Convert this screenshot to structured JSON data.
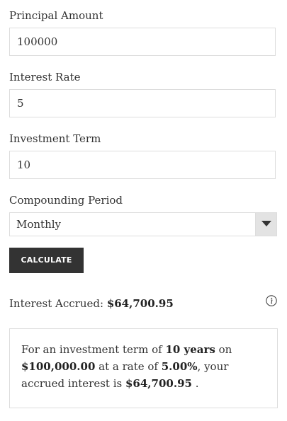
{
  "fields": {
    "principal": {
      "label": "Principal Amount",
      "value": "100000"
    },
    "rate": {
      "label": "Interest Rate",
      "value": "5"
    },
    "term": {
      "label": "Investment Term",
      "value": "10"
    },
    "compounding": {
      "label": "Compounding Period",
      "selected": "Monthly"
    }
  },
  "button": {
    "label": "CALCULATE"
  },
  "result": {
    "label": "Interest Accrued:",
    "amount": "$64,700.95"
  },
  "summary": {
    "t1": "For an investment term of ",
    "term": "10 years",
    "t2": " on ",
    "principal": "$100,000.00",
    "t3": " at a rate of ",
    "rate": "5.00%",
    "t4": ", your accrued interest is ",
    "interest": "$64,700.95",
    "t5": " ."
  },
  "icons": {
    "select_arrow": "triangle-down-icon",
    "info": "info-icon"
  }
}
